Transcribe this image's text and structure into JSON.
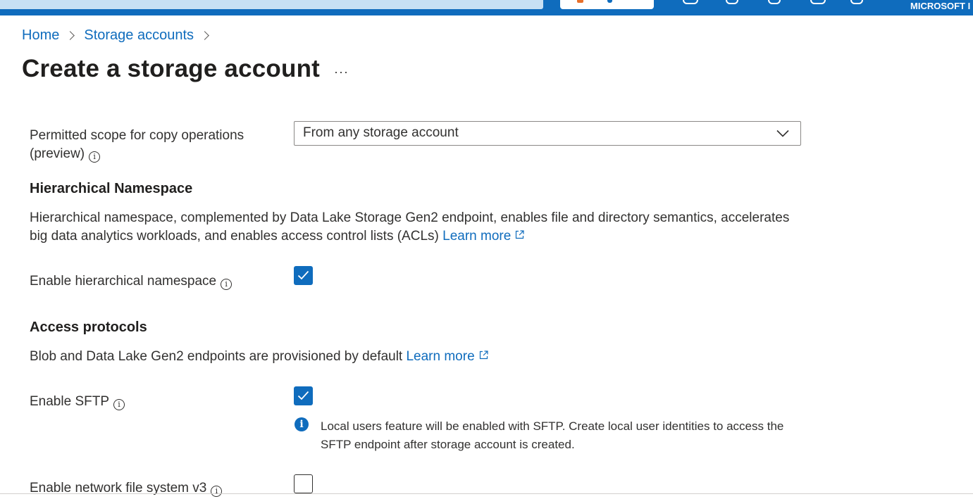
{
  "topbar": {
    "tenant": "MICROSOFT I"
  },
  "breadcrumb": {
    "items": [
      "Home",
      "Storage accounts"
    ]
  },
  "page": {
    "title": "Create a storage account",
    "more": "···"
  },
  "copy_scope": {
    "label": "Permitted scope for copy operations (preview)",
    "value": "From any storage account"
  },
  "hierarchical_namespace": {
    "title": "Hierarchical Namespace",
    "description": "Hierarchical namespace, complemented by Data Lake Storage Gen2 endpoint, enables file and directory semantics, accelerates big data analytics workloads, and enables access control lists (ACLs)",
    "learn_more": "Learn more",
    "enable_label": "Enable hierarchical namespace",
    "enabled": true
  },
  "access_protocols": {
    "title": "Access protocols",
    "description": "Blob and Data Lake Gen2 endpoints are provisioned by default",
    "learn_more": "Learn more",
    "sftp_label": "Enable SFTP",
    "sftp_enabled": true,
    "sftp_notice": "Local users feature will be enabled with SFTP. Create local user identities to access the SFTP endpoint after storage account is created.",
    "nfs_label": "Enable network file system v3",
    "nfs_enabled": false
  },
  "colors": {
    "accent": "#0f6cbd",
    "text": "#323130"
  }
}
